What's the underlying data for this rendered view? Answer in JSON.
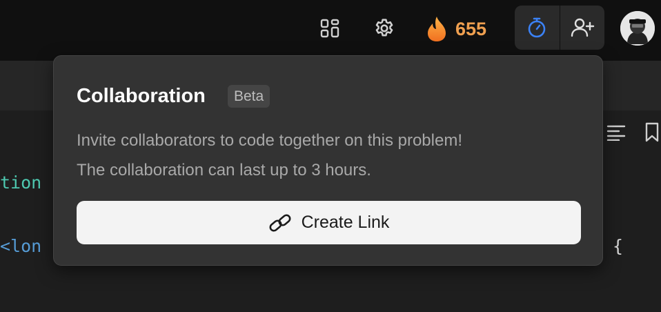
{
  "topbar": {
    "icons": {
      "layout": "layout-grid-icon",
      "settings": "gear-icon",
      "streak": "fire-icon",
      "timer": "stopwatch-icon",
      "add_user": "add-user-icon"
    },
    "streak_count": "655",
    "accent": "#3b82f6",
    "streak_color": "#f0a050"
  },
  "editor": {
    "code_fragments": {
      "line1": "tion",
      "line2": "<lon",
      "brace": "{"
    }
  },
  "popover": {
    "title": "Collaboration",
    "badge": "Beta",
    "description_line1": "Invite collaborators to code together on this problem!",
    "description_line2": "The collaboration can last up to 3 hours.",
    "button_label": "Create Link",
    "button_icon": "link-icon"
  }
}
